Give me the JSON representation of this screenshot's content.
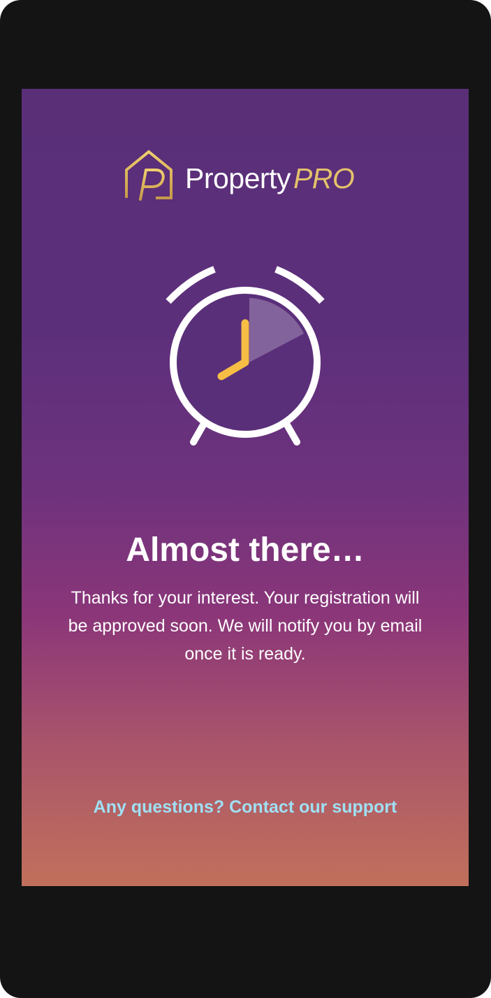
{
  "brand": {
    "name_main": "Property",
    "name_accent": "PRO",
    "logo_icon": "house-p-logo-icon"
  },
  "status": {
    "icon": "alarm-clock-icon",
    "title": "Almost there…",
    "message": "Thanks for your interest. Your registration will be approved soon. We will notify you by email once it is ready."
  },
  "support": {
    "link_label": "Any questions? Contact our support"
  },
  "colors": {
    "accent_gold": "#e3c16c",
    "clock_hand": "#f7bd45",
    "link": "#9fe0f3",
    "gradient_top": "#5a2f78",
    "gradient_bottom": "#c1705b"
  }
}
